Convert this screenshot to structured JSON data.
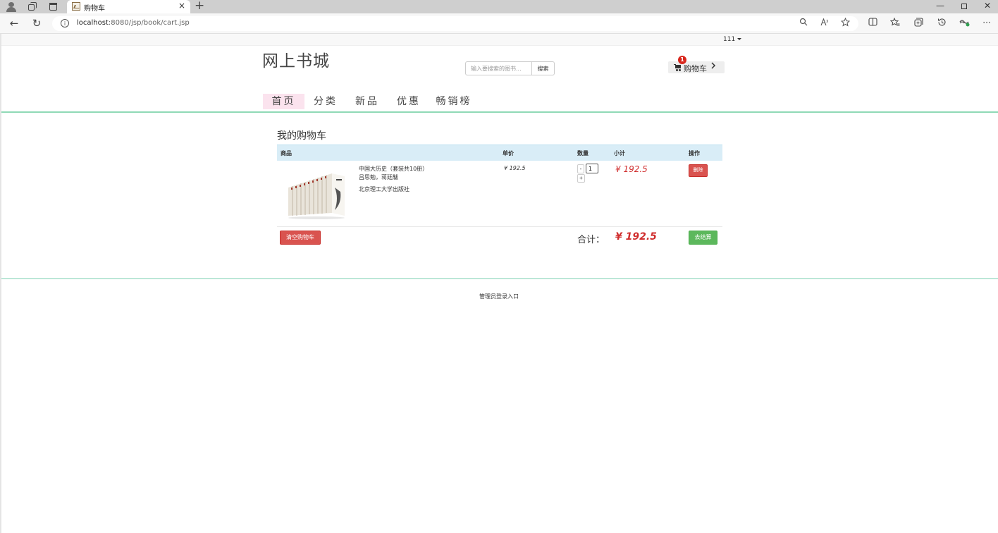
{
  "browser": {
    "tab_title": "购物车",
    "tab_close": "×",
    "new_tab": "+",
    "url_host": "localhost",
    "url_rest": ":8080/jsp/book/cart.jsp",
    "back": "←",
    "reload": "↻",
    "win_min": "—",
    "win_close": "✕",
    "more": "···"
  },
  "header": {
    "user_menu": "111",
    "site_title": "网上书城",
    "search_placeholder": "输入要搜索的图书...",
    "search_button": "搜索",
    "cart_button": "购物车",
    "cart_count": "1"
  },
  "nav": {
    "items": [
      {
        "label": "首页",
        "active": true
      },
      {
        "label": "分类",
        "active": false
      },
      {
        "label": "新品",
        "active": false
      },
      {
        "label": "优惠",
        "active": false
      },
      {
        "label": "畅销榜",
        "active": false
      }
    ]
  },
  "cart": {
    "heading": "我的购物车",
    "columns": [
      "商品",
      "单价",
      "数量",
      "小计",
      "操作"
    ],
    "items": [
      {
        "name": "中国大历史（套装共10册）",
        "author": "吕思勉，蒋廷黻",
        "publisher": "北京理工大学出版社",
        "unit_price": "¥ 192.5",
        "quantity": "1",
        "qty_minus": "-",
        "qty_plus": "+",
        "subtotal": "¥ 192.5",
        "delete_label": "删除"
      }
    ],
    "clear_label": "清空购物车",
    "total_label": "合计：",
    "total_value": "¥ 192.5",
    "checkout_label": "去结算"
  },
  "footer": {
    "admin_link": "管理员登录入口"
  },
  "colors": {
    "nav_active_bg": "#fbe3ee",
    "accent_line": "#8fd9b6",
    "danger": "#d9534f",
    "success": "#5cb85c",
    "price_red": "#d02e2e",
    "table_header_bg": "#d9edf7"
  }
}
